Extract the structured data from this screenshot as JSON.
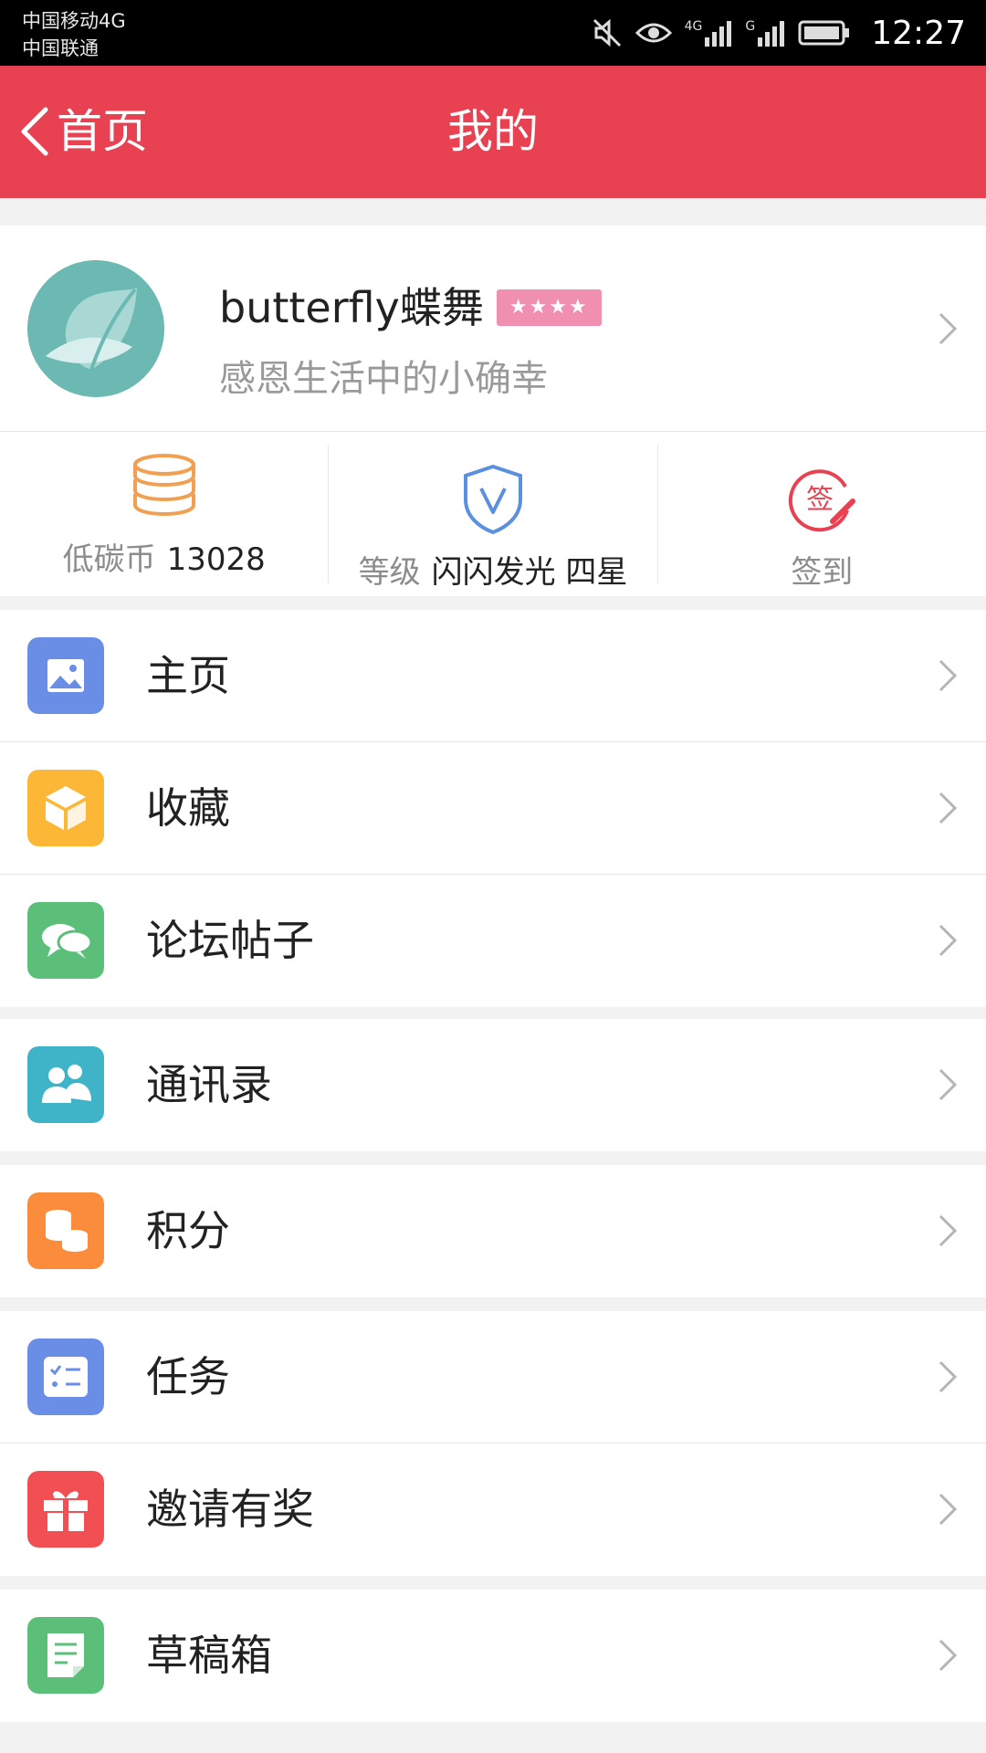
{
  "status_bar": {
    "carrier_1": "中国移动4G",
    "carrier_2": "中国联通",
    "network_1": "4G",
    "network_2": "G",
    "time": "12:27",
    "icons": [
      "mute-icon",
      "eye-icon",
      "signal-4g-icon",
      "signal-g-icon",
      "battery-icon"
    ]
  },
  "header": {
    "back_label": "首页",
    "title": "我的",
    "background": "#e84152"
  },
  "profile": {
    "username": "butterfly蝶舞",
    "stars": "★★★★",
    "signature": "感恩生活中的小确幸",
    "avatar_color": "#6cb8b3"
  },
  "stats": [
    {
      "label": "低碳币",
      "value": "13028",
      "icon": "coin-stack-icon",
      "color": "#f0a050"
    },
    {
      "label": "等级",
      "value": "闪闪发光 四星",
      "icon": "shield-v-icon",
      "color": "#5b8fe0"
    },
    {
      "label": "签到",
      "value": "",
      "icon": "sign-in-icon",
      "icon_text": "签",
      "color": "#e84152"
    }
  ],
  "menu_groups": [
    [
      {
        "label": "主页",
        "icon": "image-icon",
        "color": "#6a8ee6"
      },
      {
        "label": "收藏",
        "icon": "box-icon",
        "color": "#fbb735"
      },
      {
        "label": "论坛帖子",
        "icon": "chat-icon",
        "color": "#5bbf7a"
      }
    ],
    [
      {
        "label": "通讯录",
        "icon": "contacts-icon",
        "color": "#3fb3c8"
      }
    ],
    [
      {
        "label": "积分",
        "icon": "points-icon",
        "color": "#fb8c3c"
      }
    ],
    [
      {
        "label": "任务",
        "icon": "task-list-icon",
        "color": "#6a8ee6"
      },
      {
        "label": "邀请有奖",
        "icon": "gift-icon",
        "color": "#f24f55"
      }
    ],
    [
      {
        "label": "草稿箱",
        "icon": "draft-icon",
        "color": "#5bbf7a"
      }
    ]
  ]
}
